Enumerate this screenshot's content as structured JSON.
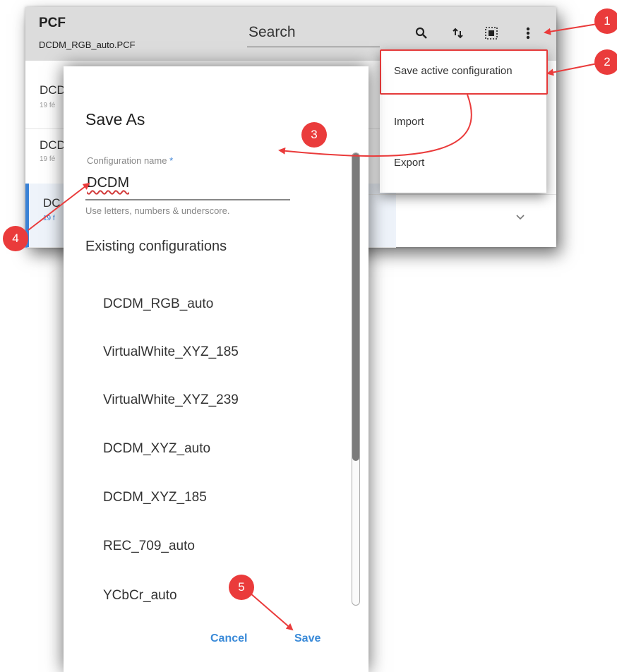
{
  "app": {
    "title": "PCF",
    "subtitle": "DCDM_RGB_auto.PCF",
    "search_placeholder": "Search",
    "icons": [
      "search-icon",
      "sort-icon",
      "select-all-icon",
      "more-vert-icon"
    ]
  },
  "background_list": {
    "rows": [
      {
        "title": "DCD",
        "date": "19 fé"
      },
      {
        "title": "DCD",
        "date": "19 fé"
      },
      {
        "title": "DC",
        "date": "19 f"
      }
    ]
  },
  "menu": {
    "items": [
      "Save active configuration",
      "Import",
      "Export"
    ]
  },
  "dialog": {
    "title": "Save As",
    "field_label": "Configuration name",
    "required_mark": "*",
    "name_value": "DCDM",
    "hint": "Use letters, numbers & underscore.",
    "existing_heading": "Existing configurations",
    "configurations": [
      "DCDM_RGB_auto",
      "VirtualWhite_XYZ_185",
      "VirtualWhite_XYZ_239",
      "DCDM_XYZ_auto",
      "DCDM_XYZ_185",
      "REC_709_auto",
      "YCbCr_auto"
    ],
    "cancel_label": "Cancel",
    "save_label": "Save"
  },
  "callouts": [
    "1",
    "2",
    "3",
    "4",
    "5"
  ],
  "colors": {
    "header_bg": "#dcdcdc",
    "accent_blue": "#3a8ad8",
    "callout_red": "#ea3b3b"
  }
}
